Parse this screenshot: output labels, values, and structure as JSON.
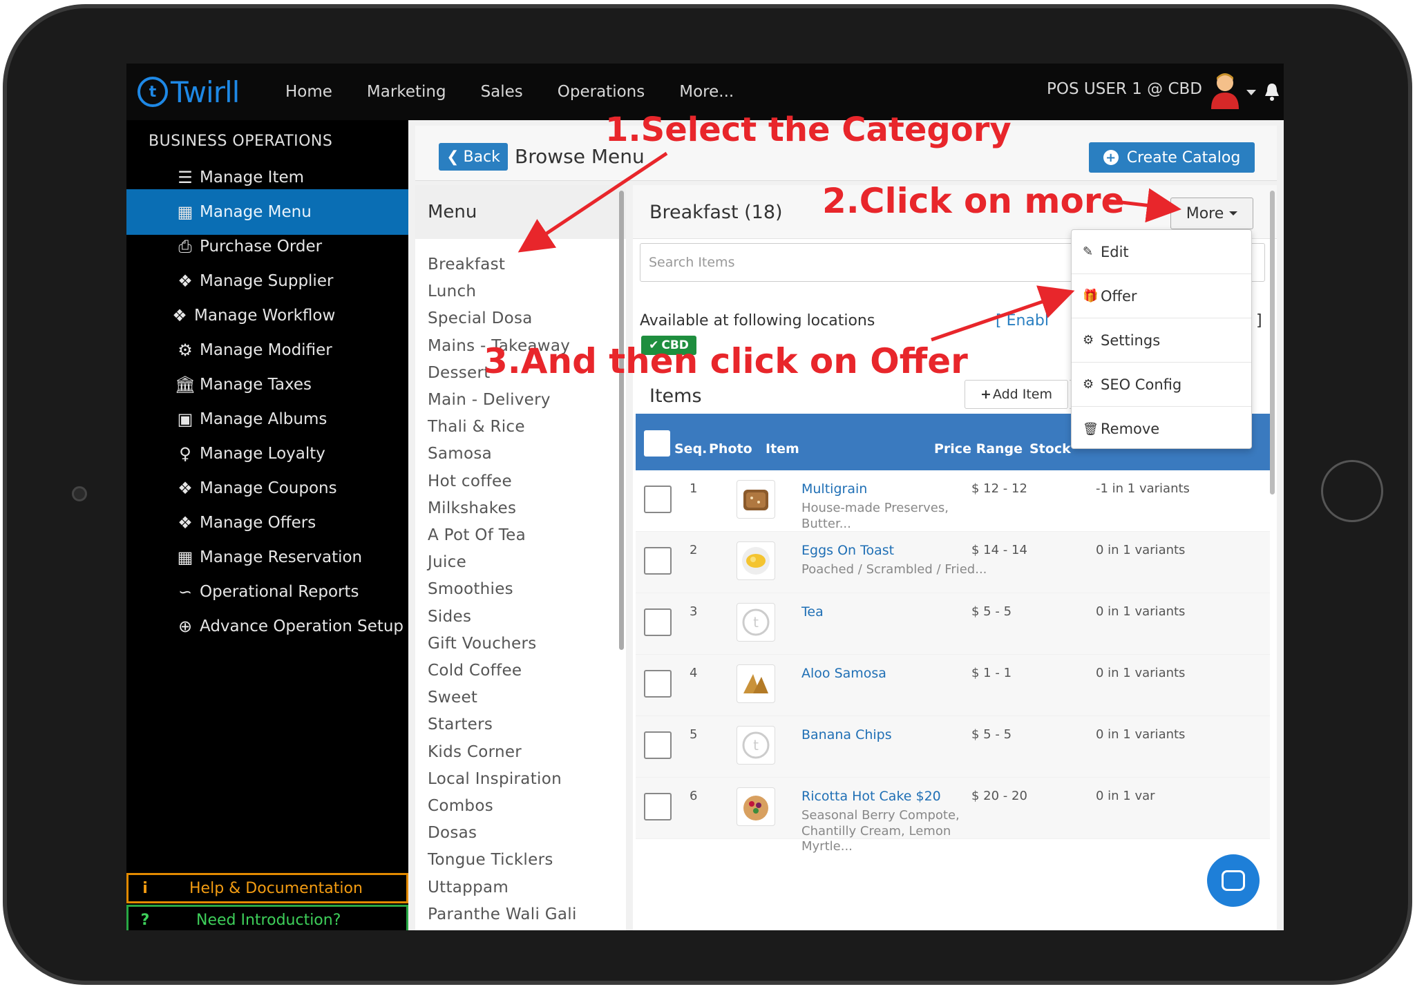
{
  "app": {
    "logo_text": "Twirll",
    "nav": [
      "Home",
      "Marketing",
      "Sales",
      "Operations",
      "More..."
    ],
    "user_label": "POS USER 1 @ CBD"
  },
  "sidebar": {
    "heading": "BUSINESS OPERATIONS",
    "items": [
      {
        "label": "Manage Item",
        "icon": "list-icon"
      },
      {
        "label": "Manage Menu",
        "icon": "table-icon",
        "active": true
      },
      {
        "label": "Purchase Order",
        "icon": "document-p-icon"
      },
      {
        "label": "Manage Supplier",
        "icon": "tags-icon"
      },
      {
        "label": "Manage Workflow",
        "icon": "tags-icon"
      },
      {
        "label": "Manage Modifier",
        "icon": "gears-icon"
      },
      {
        "label": "Manage Taxes",
        "icon": "bank-icon"
      },
      {
        "label": "Manage Albums",
        "icon": "image-icon"
      },
      {
        "label": "Manage Loyalty",
        "icon": "female-icon"
      },
      {
        "label": "Manage Coupons",
        "icon": "ticket-icon"
      },
      {
        "label": "Manage Offers",
        "icon": "tags-icon"
      },
      {
        "label": "Manage Reservation",
        "icon": "contact-book-icon"
      },
      {
        "label": "Operational Reports",
        "icon": "line-chart-icon"
      },
      {
        "label": "Advance Operation Setup",
        "icon": "plus-circle-icon"
      }
    ],
    "help_label": "Help & Documentation",
    "intro_label": "Need Introduction?"
  },
  "header": {
    "back_label": "Back",
    "title": "Browse Menu",
    "create_label": "Create Catalog"
  },
  "menu": {
    "heading": "Menu",
    "categories": [
      "Breakfast",
      "Lunch",
      "Special Dosa",
      "Mains - Takeaway",
      "Dessert",
      "Main - Delivery",
      "Thali & Rice",
      "Samosa",
      "Hot coffee",
      "Milkshakes",
      "A Pot Of Tea",
      "Juice",
      "Smoothies",
      "Sides",
      "Gift Vouchers",
      "Cold Coffee",
      "Sweet",
      "Starters",
      "Kids Corner",
      "Local Inspiration",
      "Combos",
      "Dosas",
      "Tongue Ticklers",
      "Uttappam",
      "Paranthe Wali Gali"
    ]
  },
  "items_panel": {
    "category_title": "Breakfast (18)",
    "more_label": "More",
    "search_placeholder": "Search Items",
    "locations_label": "Available at following locations",
    "enable_label": "[ Enabl",
    "bracket_close": "]",
    "location_badge": "CBD",
    "items_label": "Items",
    "add_item_label": "Add Item",
    "columns": [
      "Seq.",
      "Photo",
      "Item",
      "Price Range",
      "Stock"
    ],
    "rows": [
      {
        "seq": "1",
        "name": "Multigrain",
        "desc": "House-made Preserves, Butter...",
        "price": "$ 12 - 12",
        "stock": "-1 in 1 variants",
        "photo": "bread"
      },
      {
        "seq": "2",
        "name": "Eggs On Toast",
        "desc": "Poached / Scrambled / Fried...",
        "price": "$ 14 - 14",
        "stock": "0 in 1 variants",
        "photo": "eggs"
      },
      {
        "seq": "3",
        "name": "Tea",
        "desc": "",
        "price": "$ 5 - 5",
        "stock": "0 in 1 variants",
        "photo": "placeholder"
      },
      {
        "seq": "4",
        "name": "Aloo Samosa",
        "desc": "",
        "price": "$ 1 - 1",
        "stock": "0 in 1 variants",
        "photo": "samosa"
      },
      {
        "seq": "5",
        "name": "Banana Chips",
        "desc": "",
        "price": "$ 5 - 5",
        "stock": "0 in 1 variants",
        "photo": "placeholder"
      },
      {
        "seq": "6",
        "name": "Ricotta Hot Cake $20",
        "desc": "Seasonal Berry Compote, Chantilly Cream, Lemon Myrtle...",
        "price": "$ 20 - 20",
        "stock": "0 in 1 var",
        "photo": "hotcake"
      }
    ]
  },
  "more_menu": [
    "Edit",
    "Offer",
    "Settings",
    "SEO Config",
    "Remove"
  ],
  "annotations": {
    "step1": "1.Select the Category",
    "step2": "2.Click on more",
    "step3": "3.And then click on Offer"
  }
}
